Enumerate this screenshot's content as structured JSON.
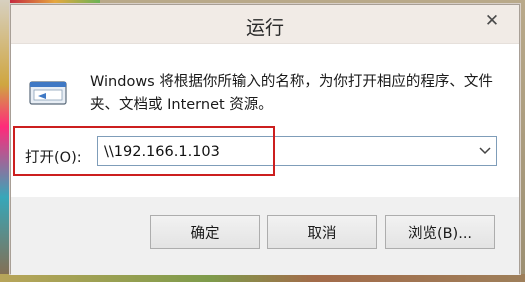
{
  "window": {
    "title": "运行",
    "close_glyph": "✕"
  },
  "dialog": {
    "description": "Windows 将根据你所输入的名称，为你打开相应的程序、文件夹、文档或 Internet 资源。",
    "open_label": "打开(O):",
    "open_value": "\\\\192.166.1.103"
  },
  "buttons": {
    "ok": "确定",
    "cancel": "取消",
    "browse": "浏览(B)..."
  },
  "icons": {
    "run": "run-program-icon",
    "dropdown": "chevron-down-icon",
    "close": "close-icon"
  },
  "colors": {
    "highlight": "#cc1f1f",
    "input_border": "#7f9db9"
  }
}
